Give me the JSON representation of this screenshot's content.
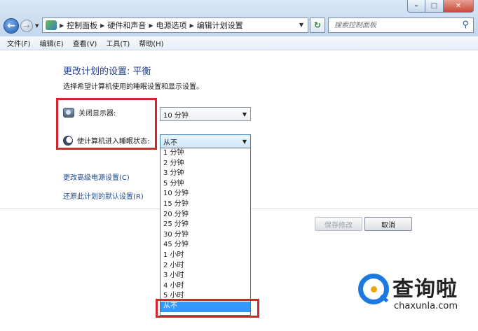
{
  "window": {
    "minimize_glyph": "–",
    "maximize_glyph": "□",
    "close_glyph": "✕"
  },
  "nav": {
    "back_glyph": "←",
    "forward_glyph": "→"
  },
  "breadcrumb": [
    "控制面板",
    "硬件和声音",
    "电源选项",
    "编辑计划设置"
  ],
  "search": {
    "placeholder": "搜索控制面板"
  },
  "menubar": [
    "文件(F)",
    "编辑(E)",
    "查看(V)",
    "工具(T)",
    "帮助(H)"
  ],
  "page": {
    "title": "更改计划的设置: 平衡",
    "subtitle": "选择希望计算机使用的睡眠设置和显示设置。"
  },
  "settings": {
    "display_label": "关闭显示器:",
    "display_value": "10 分钟",
    "sleep_label": "使计算机进入睡眠状态:",
    "sleep_value": "从不"
  },
  "dropdown_options": [
    "1 分钟",
    "2 分钟",
    "3 分钟",
    "5 分钟",
    "10 分钟",
    "15 分钟",
    "20 分钟",
    "25 分钟",
    "30 分钟",
    "45 分钟",
    "1 小时",
    "2 小时",
    "3 小时",
    "4 小时",
    "5 小时",
    "从不"
  ],
  "selected_option": "从不",
  "links": {
    "advanced": "更改高级电源设置(C)",
    "restore": "还原此计划的默认设置(R)"
  },
  "buttons": {
    "save": "保存修改",
    "cancel": "取消"
  },
  "watermark": {
    "cn": "查询啦",
    "en": "chaxunla.com"
  },
  "colors": {
    "highlight": "#d4262c",
    "selection": "#3399ff",
    "link": "#1c4a8f"
  }
}
